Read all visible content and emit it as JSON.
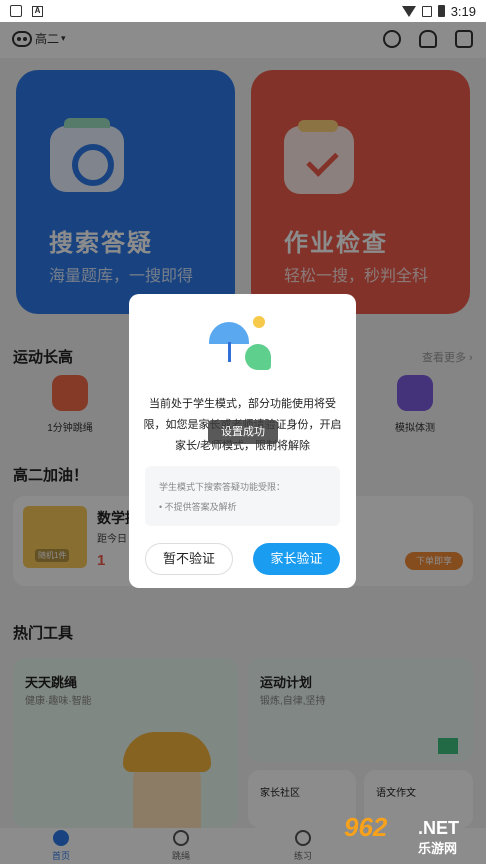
{
  "status_bar": {
    "time": "3:19"
  },
  "header": {
    "grade": "高二",
    "grade_caret": "▾"
  },
  "cards": [
    {
      "title": "搜索答疑",
      "subtitle": "海量题库，一搜即得",
      "color": "#2f7bea"
    },
    {
      "title": "作业检查",
      "subtitle": "轻松一搜，秒判全科",
      "color": "#ee5b4b"
    }
  ],
  "sport": {
    "title": "运动长高",
    "more": "查看更多 ›",
    "items": [
      {
        "label": "1分钟跳绳"
      },
      {
        "label": "模拟体测"
      }
    ]
  },
  "study": {
    "title": "高二加油！",
    "card_title": "数学提",
    "card_sub": "距今日",
    "card_num": "1",
    "thumb_label": "随机1件",
    "order_button": "下单即享"
  },
  "tools": {
    "title": "热门工具",
    "items": [
      {
        "title": "天天跳绳",
        "subtitle": "健康·趣味·智能"
      },
      {
        "title": "运动计划",
        "subtitle": "锻炼,自律,坚持"
      },
      {
        "title": "家长社区",
        "subtitle": ""
      },
      {
        "title": "语文作文",
        "subtitle": ""
      }
    ]
  },
  "nav": [
    {
      "label": "首页"
    },
    {
      "label": "跳绳"
    },
    {
      "label": "练习"
    }
  ],
  "dialog": {
    "message": "当前处于学生模式，部分功能使用将受限，如您是家长或老师请验证身份，开启家长/老师模式，限制将解除",
    "note_title": "学生模式下搜索答疑功能受限：",
    "note_item": "• 不提供答案及解析",
    "skip_button": "暂不验证",
    "verify_button": "家长验证"
  },
  "toast": "设置成功",
  "watermark": {
    "num": "962",
    "net": ".NET",
    "cn": "乐游网"
  }
}
